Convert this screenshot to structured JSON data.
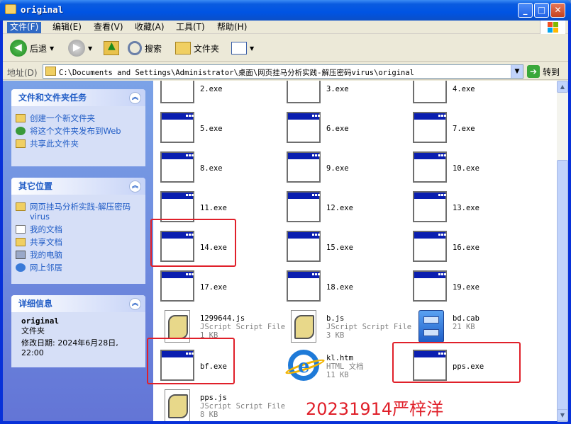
{
  "window": {
    "title": "original"
  },
  "menu": [
    "文件(F)",
    "编辑(E)",
    "查看(V)",
    "收藏(A)",
    "工具(T)",
    "帮助(H)"
  ],
  "toolbar": {
    "back": "后退",
    "search": "搜索",
    "folders": "文件夹"
  },
  "address": {
    "label": "地址(D)",
    "value": "C:\\Documents and Settings\\Administrator\\桌面\\网页挂马分析实践-解压密码virus\\original",
    "go": "转到"
  },
  "panels": {
    "tasks": {
      "title": "文件和文件夹任务",
      "items": [
        "创建一个新文件夹",
        "将这个文件夹发布到Web",
        "共享此文件夹"
      ]
    },
    "places": {
      "title": "其它位置",
      "items": [
        "网页挂马分析实践-解压密码virus",
        "我的文档",
        "共享文档",
        "我的电脑",
        "网上邻居"
      ]
    },
    "details": {
      "title": "详细信息",
      "name": "original",
      "type": "文件夹",
      "modified": "修改日期: 2024年6月28日, 22:00"
    }
  },
  "files": [
    {
      "name": "2.exe",
      "kind": "exe"
    },
    {
      "name": "3.exe",
      "kind": "exe"
    },
    {
      "name": "4.exe",
      "kind": "exe"
    },
    {
      "name": "5.exe",
      "kind": "exe"
    },
    {
      "name": "6.exe",
      "kind": "exe"
    },
    {
      "name": "7.exe",
      "kind": "exe"
    },
    {
      "name": "8.exe",
      "kind": "exe"
    },
    {
      "name": "9.exe",
      "kind": "exe"
    },
    {
      "name": "10.exe",
      "kind": "exe"
    },
    {
      "name": "11.exe",
      "kind": "exe"
    },
    {
      "name": "12.exe",
      "kind": "exe"
    },
    {
      "name": "13.exe",
      "kind": "exe"
    },
    {
      "name": "14.exe",
      "kind": "exe"
    },
    {
      "name": "15.exe",
      "kind": "exe"
    },
    {
      "name": "16.exe",
      "kind": "exe"
    },
    {
      "name": "17.exe",
      "kind": "exe"
    },
    {
      "name": "18.exe",
      "kind": "exe"
    },
    {
      "name": "19.exe",
      "kind": "exe"
    },
    {
      "name": "1299644.js",
      "kind": "js",
      "type": "JScript Script File",
      "size": "1 KB"
    },
    {
      "name": "b.js",
      "kind": "js",
      "type": "JScript Script File",
      "size": "3 KB"
    },
    {
      "name": "bd.cab",
      "kind": "cab",
      "size": "21 KB"
    },
    {
      "name": "bf.exe",
      "kind": "exe"
    },
    {
      "name": "kl.htm",
      "kind": "htm",
      "type": "HTML 文档",
      "size": "11 KB"
    },
    {
      "name": "pps.exe",
      "kind": "exe"
    },
    {
      "name": "pps.js",
      "kind": "js",
      "type": "JScript Script File",
      "size": "8 KB"
    }
  ],
  "annotation": "20231914严梓洋",
  "colors": {
    "highlight": "#e0202a",
    "titlebar": "#0054e3",
    "link": "#215dc6"
  }
}
